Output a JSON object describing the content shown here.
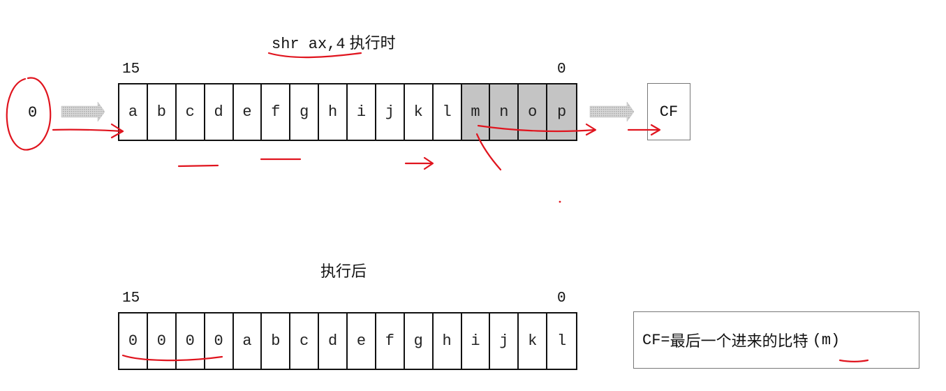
{
  "before": {
    "code": "shr ax,4",
    "label": "执行时",
    "bit_high": "15",
    "bit_low": "0",
    "input_bit": "0",
    "cells": [
      "a",
      "b",
      "c",
      "d",
      "e",
      "f",
      "g",
      "h",
      "i",
      "j",
      "k",
      "l",
      "m",
      "n",
      "o",
      "p"
    ],
    "shaded_from_index": 12,
    "cf_label": "CF"
  },
  "after": {
    "label": "执行后",
    "bit_high": "15",
    "bit_low": "0",
    "cells": [
      "0",
      "0",
      "0",
      "0",
      "a",
      "b",
      "c",
      "d",
      "e",
      "f",
      "g",
      "h",
      "i",
      "j",
      "k",
      "l"
    ]
  },
  "note": {
    "prefix": "CF=",
    "text": "最后一个进来的比特",
    "suffix": "(m)"
  },
  "colors": {
    "shaded_cell": "#c4c4c4",
    "annotation_ink": "#e0141e",
    "arrow_fill": "#b8b8b8"
  }
}
